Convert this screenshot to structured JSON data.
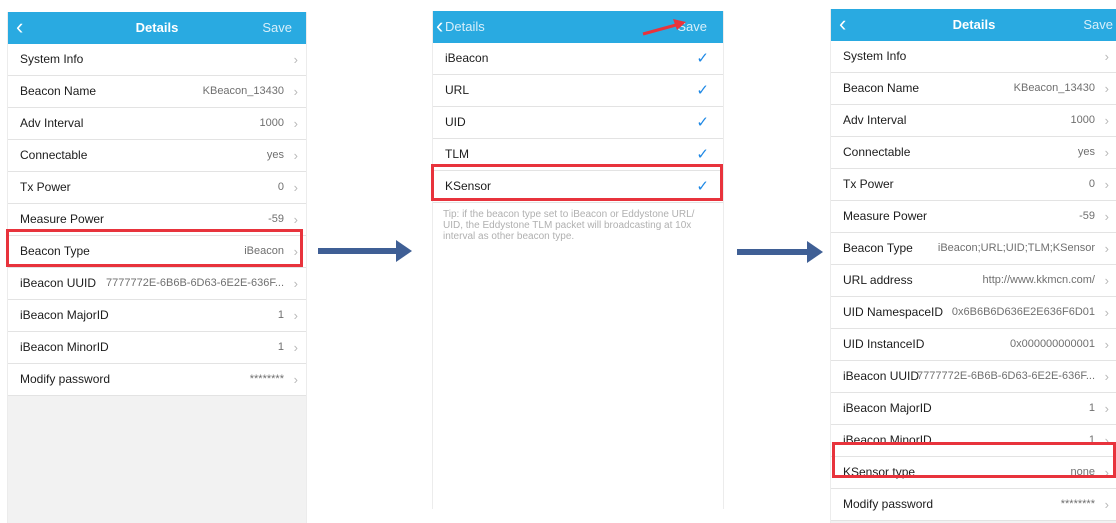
{
  "left": {
    "nav": {
      "back": "‹",
      "title": "Details",
      "save": "Save"
    },
    "rows": [
      {
        "label": "System Info",
        "value": ""
      },
      {
        "label": "Beacon Name",
        "value": "KBeacon_13430"
      },
      {
        "label": "Adv Interval",
        "value": "1000"
      },
      {
        "label": "Connectable",
        "value": "yes"
      },
      {
        "label": "Tx Power",
        "value": "0"
      },
      {
        "label": "Measure Power",
        "value": "-59"
      },
      {
        "label": "Beacon Type",
        "value": "iBeacon"
      },
      {
        "label": "iBeacon UUID",
        "value": "7777772E-6B6B-6D63-6E2E-636F..."
      },
      {
        "label": "iBeacon MajorID",
        "value": "1"
      },
      {
        "label": "iBeacon MinorID",
        "value": "1"
      },
      {
        "label": "Modify password",
        "value": "********"
      }
    ]
  },
  "middle": {
    "nav": {
      "back": "‹",
      "back_label": "Details",
      "save": "Save"
    },
    "types": [
      {
        "label": "iBeacon",
        "check": "✓"
      },
      {
        "label": "URL",
        "check": "✓"
      },
      {
        "label": "UID",
        "check": "✓"
      },
      {
        "label": "TLM",
        "check": "✓"
      },
      {
        "label": "KSensor",
        "check": "✓"
      }
    ],
    "tip": "Tip: if the beacon type set to iBeacon or Eddystone URL/ UID, the Eddystone TLM packet will broadcasting at 10x interval as other beacon type."
  },
  "right": {
    "nav": {
      "back": "‹",
      "title": "Details",
      "save": "Save"
    },
    "rows": [
      {
        "label": "System Info",
        "value": ""
      },
      {
        "label": "Beacon Name",
        "value": "KBeacon_13430"
      },
      {
        "label": "Adv Interval",
        "value": "1000"
      },
      {
        "label": "Connectable",
        "value": "yes"
      },
      {
        "label": "Tx Power",
        "value": "0"
      },
      {
        "label": "Measure Power",
        "value": "-59"
      },
      {
        "label": "Beacon Type",
        "value": "iBeacon;URL;UID;TLM;KSensor"
      },
      {
        "label": "URL address",
        "value": "http://www.kkmcn.com/"
      },
      {
        "label": "UID NamespaceID",
        "value": "0x6B6B6D636E2E636F6D01"
      },
      {
        "label": "UID InstanceID",
        "value": "0x000000000001"
      },
      {
        "label": "iBeacon UUID",
        "value": "7777772E-6B6B-6D63-6E2E-636F..."
      },
      {
        "label": "iBeacon MajorID",
        "value": "1"
      },
      {
        "label": "iBeacon MinorID",
        "value": "1"
      },
      {
        "label": "KSensor type",
        "value": "none"
      },
      {
        "label": "Modify password",
        "value": "********"
      }
    ]
  },
  "chevron": "›",
  "colors": {
    "navbar": "#29aae1",
    "highlight": "#e8333c",
    "flow_arrow": "#3f5f95",
    "check": "#1e88e5"
  },
  "icons": [
    "back-chevron-icon",
    "row-chevron-icon",
    "checkmark-icon",
    "flow-arrow-icon",
    "annotation-arrow-icon"
  ]
}
